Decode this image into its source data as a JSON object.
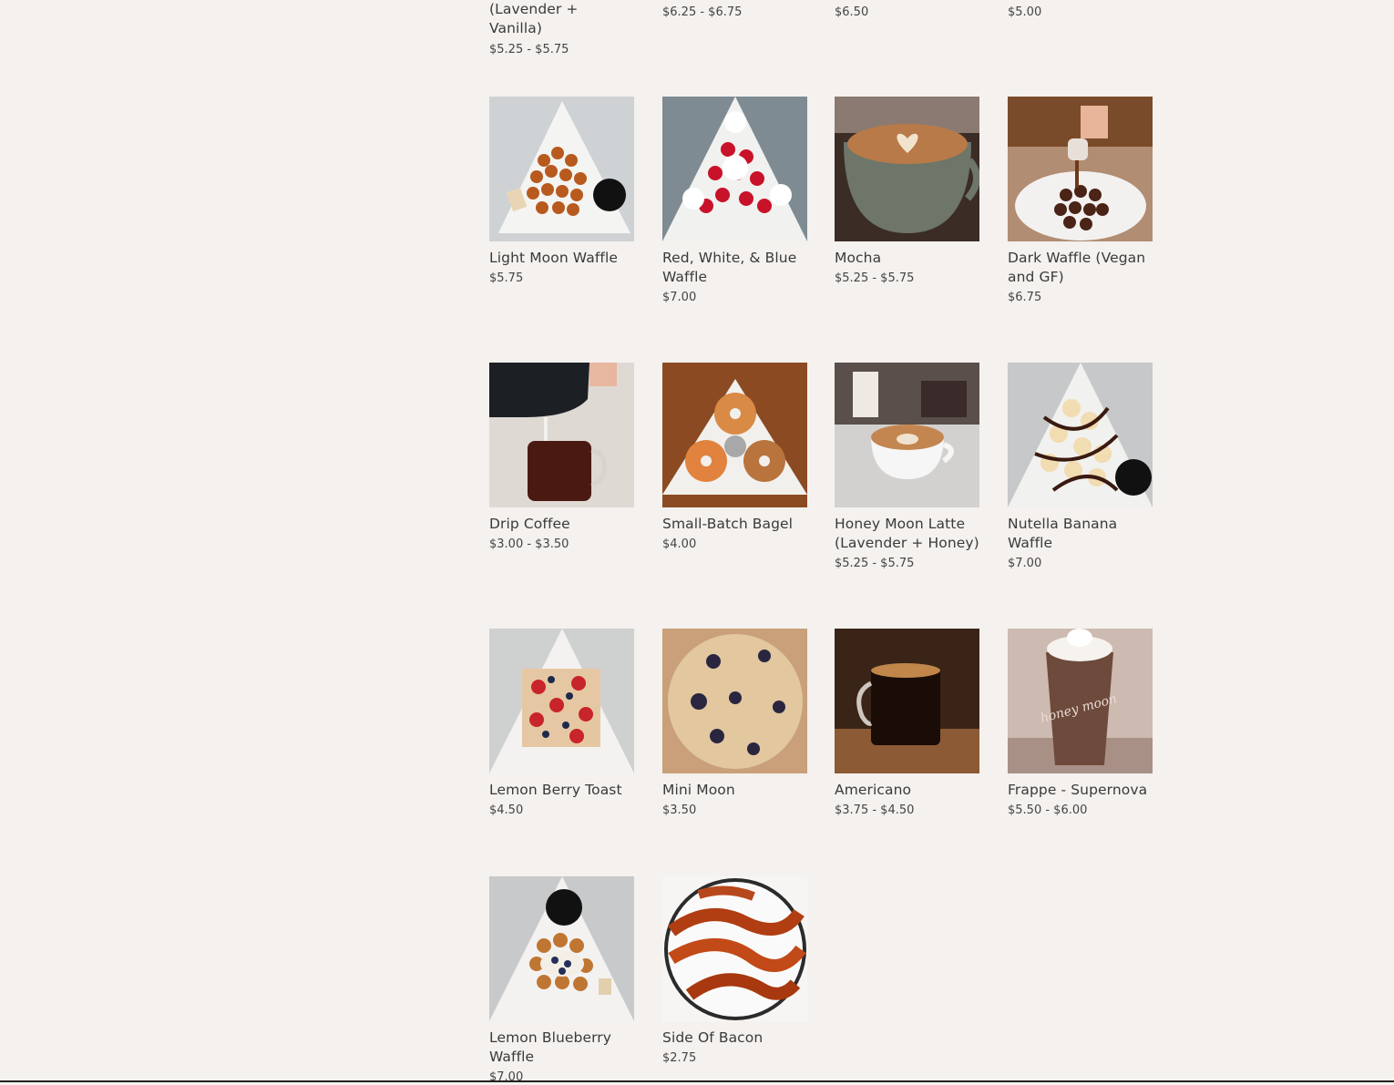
{
  "products_top_row": [
    {
      "name_tail": "(Lavender + Vanilla)",
      "price": "$5.25 - $5.75"
    },
    {
      "name_tail": "",
      "price": "$6.25 - $6.75"
    },
    {
      "name_tail": "",
      "price": "$6.50"
    },
    {
      "name_tail": "",
      "price": "$5.00"
    }
  ],
  "products": [
    {
      "name": "Light Moon Waffle",
      "price": "$5.75",
      "image": "waffle-with-syrup"
    },
    {
      "name": "Red, White, & Blue Waffle",
      "price": "$7.00",
      "image": "waffle-with-strawberries-and-cream"
    },
    {
      "name": "Mocha",
      "price": "$5.25 - $5.75",
      "image": "latte-cup"
    },
    {
      "name": "Dark Waffle (Vegan and GF)",
      "price": "$6.75",
      "image": "chocolate-waffle-with-syrup"
    },
    {
      "name": "Drip Coffee",
      "price": "$3.00 - $3.50",
      "image": "coffee-glass"
    },
    {
      "name": "Small-Batch Bagel",
      "price": "$4.00",
      "image": "bagels-plate"
    },
    {
      "name": "Honey Moon Latte (Lavender + Honey)",
      "price": "$5.25 - $5.75",
      "image": "latte-cup"
    },
    {
      "name": "Nutella Banana Waffle",
      "price": "$7.00",
      "image": "banana-waffle"
    },
    {
      "name": "Lemon Berry Toast",
      "price": "$4.50",
      "image": "berry-toast"
    },
    {
      "name": "Mini Moon",
      "price": "$3.50",
      "image": "blueberry-muffin"
    },
    {
      "name": "Americano",
      "price": "$3.75 - $4.50",
      "image": "americano-glass"
    },
    {
      "name": "Frappe - Supernova",
      "price": "$5.50 - $6.00",
      "image": "frappe-cup"
    },
    {
      "name": "Lemon Blueberry Waffle",
      "price": "$7.00",
      "image": "blueberry-waffle"
    },
    {
      "name": "Side Of Bacon",
      "price": "$2.75",
      "image": "bacon-plate"
    }
  ],
  "frappe_cup_text": "honey moon"
}
